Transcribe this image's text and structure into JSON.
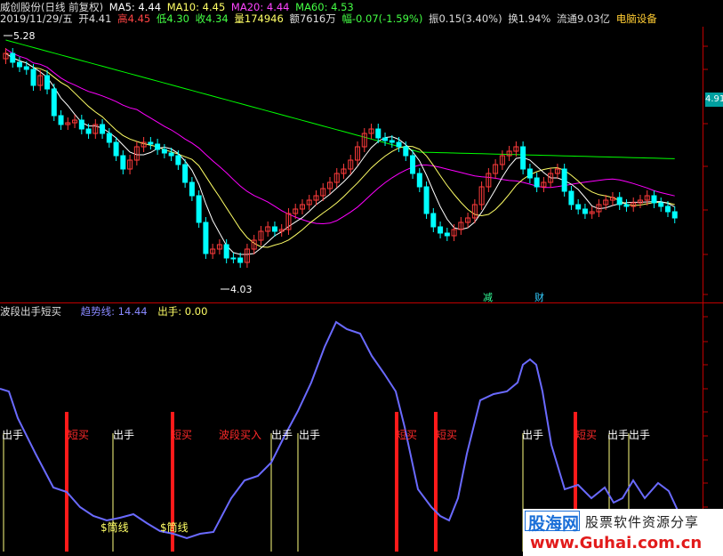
{
  "header": {
    "stock_title": "威创股份(日线 前复权)",
    "ma5_label": "MA5: 4.44",
    "ma10_label": "MA10: 4.45",
    "ma20_label": "MA20: 4.44",
    "ma60_label": "MA60: 4.53",
    "date": "2019/11/29/五",
    "open": "开4.41",
    "high": "高4.45",
    "low": "低4.30",
    "close": "收4.34",
    "volume": "量174946",
    "amount": "额7616万",
    "change": "幅-0.07(-1.59%)",
    "amplitude": "振0.15(3.40%)",
    "turnover": "换1.94%",
    "float": "流通9.03亿",
    "sector": "电脑设备"
  },
  "price_labels": {
    "high_mark": "5.28",
    "low_mark": "4.03",
    "current_axis": "4.91"
  },
  "markers": {
    "jian": "减",
    "cai": "财"
  },
  "indicator": {
    "title": "波段出手短买",
    "trend_label": "趋势线: 14.44",
    "out_label": "出手: 0.00"
  },
  "signals": {
    "out": "出手",
    "short_buy": "短买",
    "band_buy": "波段买入",
    "money_line": "$筒线"
  },
  "watermark": {
    "brand": "股海网",
    "slogan": "股票软件资源分享",
    "url": "www.Guhai.com.cn"
  },
  "colors": {
    "up": "#ff3b3b",
    "down": "#00ffff",
    "ma5": "#ffffff",
    "ma10": "#ffff66",
    "ma20": "#ff00ff",
    "ma60": "#00ff00",
    "trend": "#6a6aff",
    "signal_red": "#ff1a1a",
    "signal_yellow": "#ffff80"
  }
}
